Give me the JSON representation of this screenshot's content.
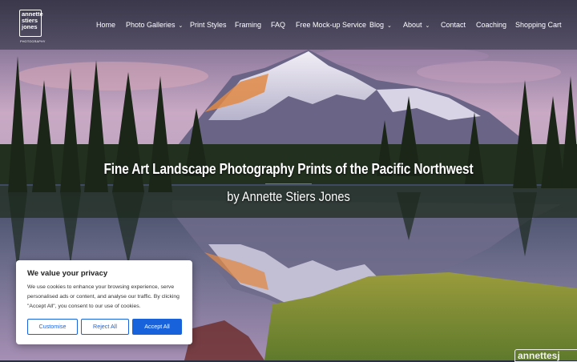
{
  "logo": {
    "lines": [
      "annette",
      "stiers",
      "jones"
    ],
    "sub": "PHOTOGRAPHY"
  },
  "nav": [
    {
      "label": "Home",
      "has_caret": false
    },
    {
      "label": "Photo Galleries",
      "has_caret": true
    },
    {
      "label": "Print Styles",
      "has_caret": false
    },
    {
      "label": "Framing",
      "has_caret": false
    },
    {
      "label": "FAQ",
      "has_caret": false
    },
    {
      "label": "Free Mock-up Service",
      "has_caret": false
    },
    {
      "label": "Blog",
      "has_caret": true
    },
    {
      "label": "About",
      "has_caret": true
    },
    {
      "label": "Contact",
      "has_caret": false
    },
    {
      "label": "Coaching",
      "has_caret": false
    },
    {
      "label": "Shopping Cart",
      "has_caret": false
    }
  ],
  "hero": {
    "title": "Fine Art Landscape Photography Prints of the Pacific Northwest",
    "subtitle": "by Annette Stiers Jones",
    "accent_color": "#2f8fc1"
  },
  "cookie": {
    "title": "We value your privacy",
    "text": "We use cookies to enhance your browsing experience, serve personalised ads or content, and analyse our traffic. By clicking \"Accept All\", you consent to our use of cookies.",
    "customise": "Customise",
    "reject": "Reject All",
    "accept": "Accept All",
    "accent_color": "#1863dc"
  },
  "watermark": "annettesj"
}
